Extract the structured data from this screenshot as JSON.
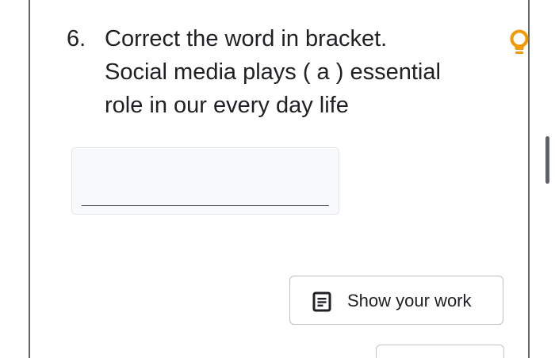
{
  "question": {
    "number": "6.",
    "lines": [
      "Correct the word in bracket.",
      "Social media plays ( a ) essential",
      "role in our every day life"
    ]
  },
  "answer": {
    "value": "",
    "placeholder": ""
  },
  "show_work": {
    "label": "Show your work",
    "icon": "notes-icon"
  },
  "hint": {
    "icon": "lightbulb-icon",
    "color": "#f29900"
  },
  "colors": {
    "text": "#202124",
    "border": "#5f6368",
    "input_background": "#f8f9fa"
  }
}
